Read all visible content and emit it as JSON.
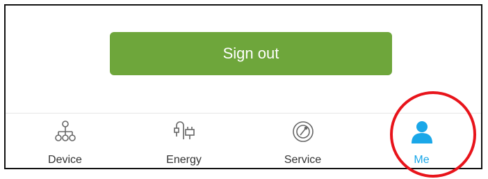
{
  "main": {
    "sign_out_label": "Sign out"
  },
  "tabbar": {
    "tabs": [
      {
        "label": "Device",
        "icon": "device-tree-icon",
        "active": false
      },
      {
        "label": "Energy",
        "icon": "energy-icon",
        "active": false
      },
      {
        "label": "Service",
        "icon": "service-icon",
        "active": false
      },
      {
        "label": "Me",
        "icon": "person-icon",
        "active": true
      }
    ]
  },
  "colors": {
    "sign_out_button": "#6ea63b",
    "active_tab": "#1aa7e8",
    "inactive_icon": "#666666",
    "highlight_circle": "#e8141b"
  }
}
